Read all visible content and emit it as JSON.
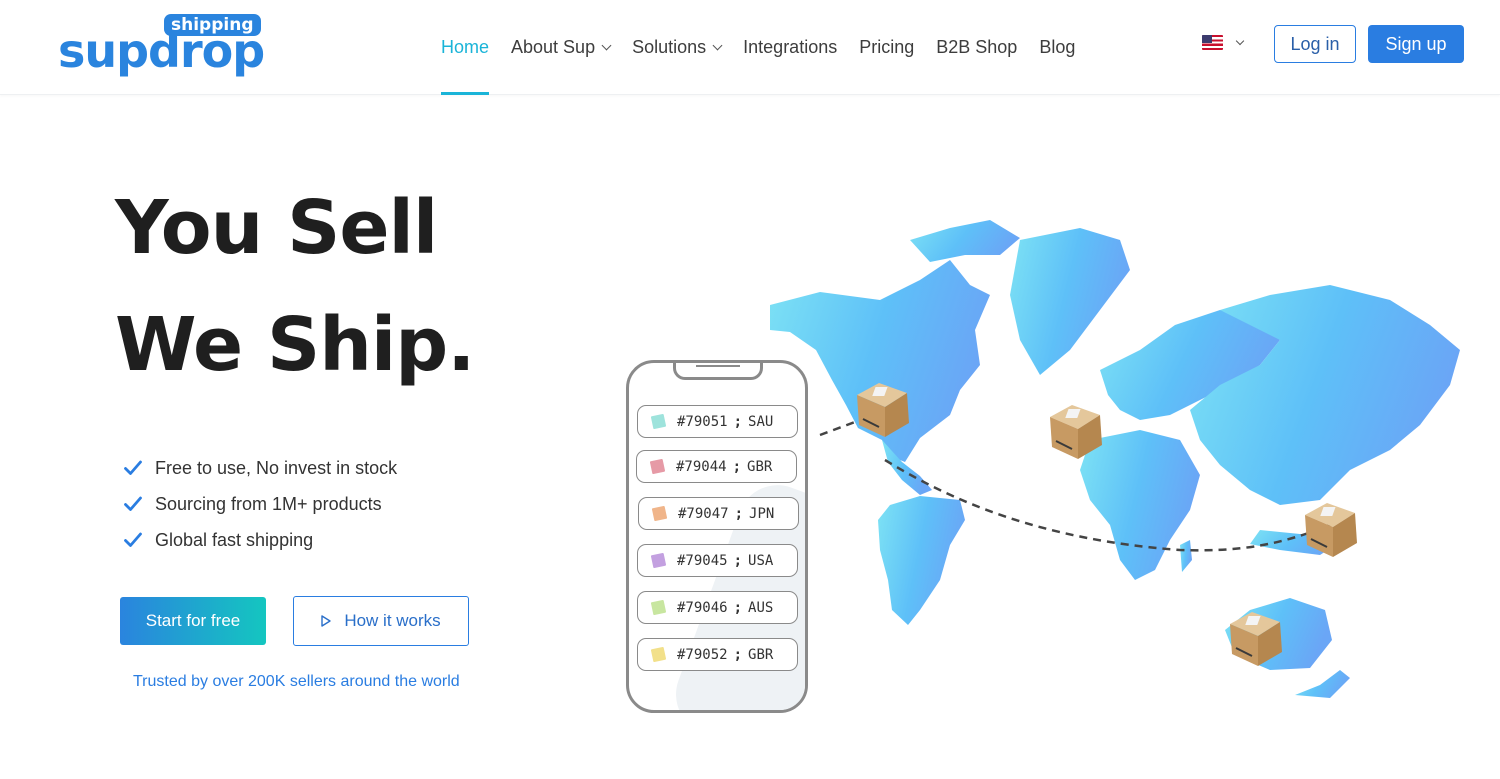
{
  "brand": {
    "word": "supdrop",
    "tag": "shipping",
    "color": "#2a84de"
  },
  "nav": {
    "items": [
      {
        "label": "Home",
        "active": true,
        "dropdown": false
      },
      {
        "label": "About Sup",
        "active": false,
        "dropdown": true
      },
      {
        "label": "Solutions",
        "active": false,
        "dropdown": true
      },
      {
        "label": "Integrations",
        "active": false,
        "dropdown": false
      },
      {
        "label": "Pricing",
        "active": false,
        "dropdown": false
      },
      {
        "label": "B2B Shop",
        "active": false,
        "dropdown": false
      },
      {
        "label": "Blog",
        "active": false,
        "dropdown": false
      }
    ],
    "language_icon": "us-flag-icon",
    "login_label": "Log in",
    "signup_label": "Sign up"
  },
  "hero": {
    "headline_line1": "You Sell",
    "headline_line2": "We Ship.",
    "features": [
      "Free to use, No invest in stock",
      "Sourcing from 1M+ products",
      "Global fast shipping"
    ],
    "start_label": "Start for free",
    "how_label": "How it works",
    "trusted_text": "Trusted by over 200K sellers around the world"
  },
  "orders": [
    {
      "id": "#79051",
      "country": "SAU",
      "color": "#9ee3dc"
    },
    {
      "id": "#79044",
      "country": "GBR",
      "color": "#e69aa6"
    },
    {
      "id": "#79047",
      "country": "JPN",
      "color": "#f0b58a"
    },
    {
      "id": "#79045",
      "country": "USA",
      "color": "#c3a0e0"
    },
    {
      "id": "#79046",
      "country": "AUS",
      "color": "#c8e6a0"
    },
    {
      "id": "#79052",
      "country": "GBR",
      "color": "#f2e08a"
    }
  ],
  "colors": {
    "accent": "#1ab4d8",
    "primary": "#2a7de1",
    "headline": "#1f1f1f"
  }
}
